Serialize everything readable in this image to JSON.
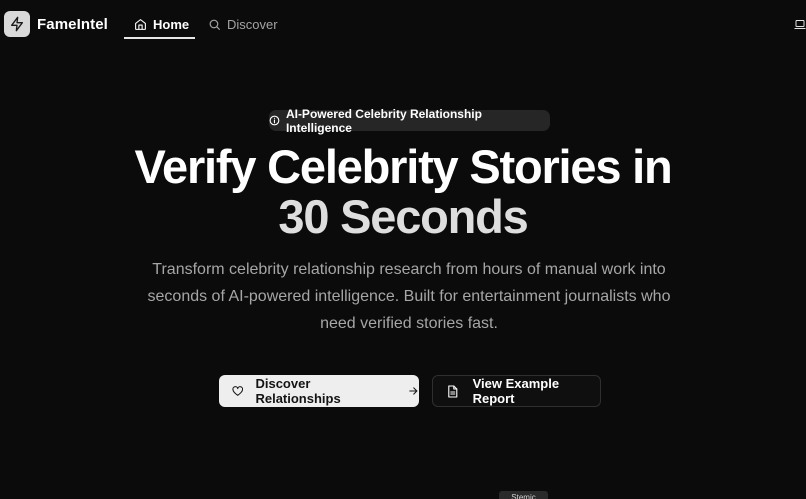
{
  "header": {
    "brand": "FameIntel",
    "nav": {
      "home": "Home",
      "discover": "Discover"
    }
  },
  "hero": {
    "badge": "AI-Powered Celebrity Relationship Intelligence",
    "title_line1": "Verify Celebrity Stories in",
    "title_line2": "30 Seconds",
    "subtitle": "Transform celebrity relationship research from hours of manual work into seconds of AI-powered intelligence. Built for entertainment journalists who need verified stories fast.",
    "primary_button": "Discover Relationships",
    "secondary_button": "View Example Report"
  },
  "bottom_peek": {
    "label": "Stemic"
  },
  "icons": {
    "logo": "lightning-bolt-icon",
    "home": "home-icon",
    "discover": "search-icon",
    "right": "laptop-icon",
    "badge": "info-icon",
    "primary": "heart-icon",
    "primary_trailing": "arrow-right-icon",
    "secondary": "document-icon"
  },
  "colors": {
    "background": "#0b0b0b",
    "primary_button_bg": "#eeeeee",
    "badge_bg": "#262626"
  }
}
